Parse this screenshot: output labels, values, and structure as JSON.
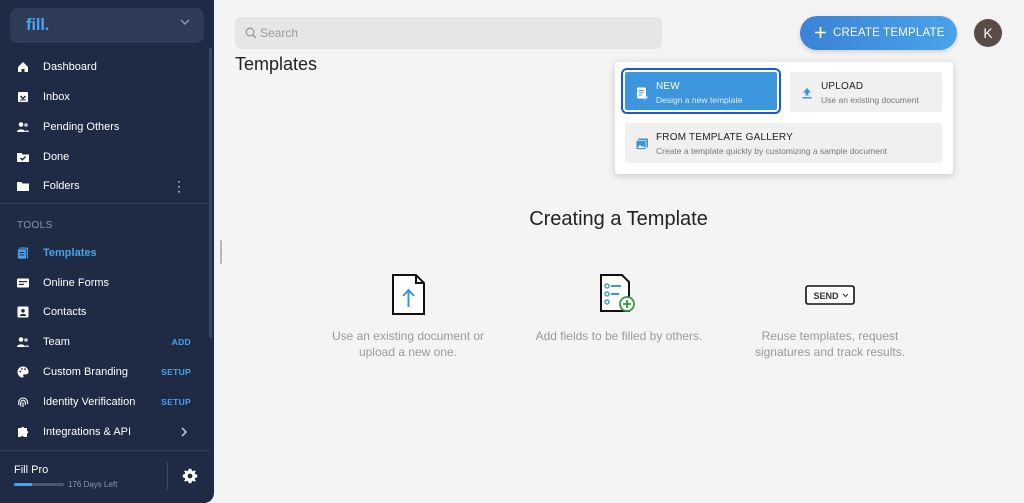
{
  "app": {
    "logo": "fill."
  },
  "sidebar": {
    "nav": [
      {
        "label": "Dashboard",
        "icon": "home-icon"
      },
      {
        "label": "Inbox",
        "icon": "inbox-icon"
      },
      {
        "label": "Pending Others",
        "icon": "people-icon"
      },
      {
        "label": "Done",
        "icon": "done-folder-icon"
      },
      {
        "label": "Folders",
        "icon": "folder-icon"
      }
    ],
    "tools_label": "TOOLS",
    "tools": [
      {
        "label": "Templates",
        "icon": "templates-icon",
        "active": true
      },
      {
        "label": "Online Forms",
        "icon": "forms-icon"
      },
      {
        "label": "Contacts",
        "icon": "contacts-icon"
      },
      {
        "label": "Team",
        "icon": "team-icon",
        "tag": "ADD"
      },
      {
        "label": "Custom Branding",
        "icon": "palette-icon",
        "tag": "SETUP"
      },
      {
        "label": "Identity Verification",
        "icon": "fingerprint-icon",
        "tag": "SETUP"
      },
      {
        "label": "Integrations & API",
        "icon": "puzzle-icon"
      }
    ],
    "plan": {
      "name": "Fill Pro",
      "days_left": "176 Days Left",
      "progress": 0.35
    }
  },
  "header": {
    "search_placeholder": "Search",
    "create_button": "CREATE TEMPLATE",
    "avatar_initial": "K"
  },
  "page": {
    "title": "Templates"
  },
  "dropdown": {
    "new": {
      "title": "NEW",
      "subtitle": "Design a new template"
    },
    "upload": {
      "title": "UPLOAD",
      "subtitle": "Use an existing document"
    },
    "gallery": {
      "title": "FROM TEMPLATE GALLERY",
      "subtitle": "Create a template quickly by customizing a sample document"
    }
  },
  "empty_state": {
    "heading": "Creating a Template",
    "steps": [
      {
        "icon": "upload-document-icon",
        "text": "Use an existing document or upload a new one."
      },
      {
        "icon": "add-fields-icon",
        "text": "Add fields to be filled by others."
      },
      {
        "icon": "send-button-icon",
        "badge": "SEND",
        "text": "Reuse templates, request signatures and track results."
      }
    ]
  },
  "colors": {
    "sidebar": "#1f2a44",
    "accent": "#4aa3ea",
    "highlight_border": "#1a5ad6"
  }
}
